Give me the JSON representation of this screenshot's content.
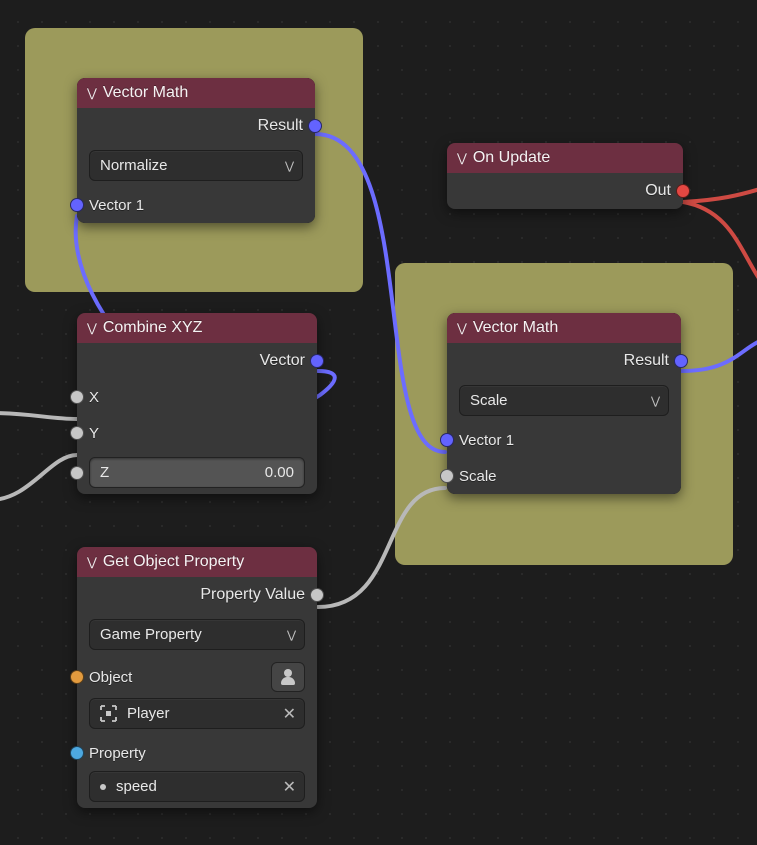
{
  "nodes": {
    "vectorMath1": {
      "title": "Vector Math",
      "output": "Result",
      "operation": "Normalize",
      "input1": "Vector 1"
    },
    "combineXYZ": {
      "title": "Combine XYZ",
      "output": "Vector",
      "inX": "X",
      "inY": "Y",
      "inZ": "Z",
      "zValue": "0.00"
    },
    "getObjectProperty": {
      "title": "Get Object Property",
      "output": "Property Value",
      "mode": "Game Property",
      "objectLabel": "Object",
      "objectValue": "Player",
      "propertyLabel": "Property",
      "propertyValue": "speed"
    },
    "onUpdate": {
      "title": "On Update",
      "output": "Out"
    },
    "vectorMath2": {
      "title": "Vector Math",
      "output": "Result",
      "operation": "Scale",
      "input1": "Vector 1",
      "input2": "Scale"
    }
  }
}
